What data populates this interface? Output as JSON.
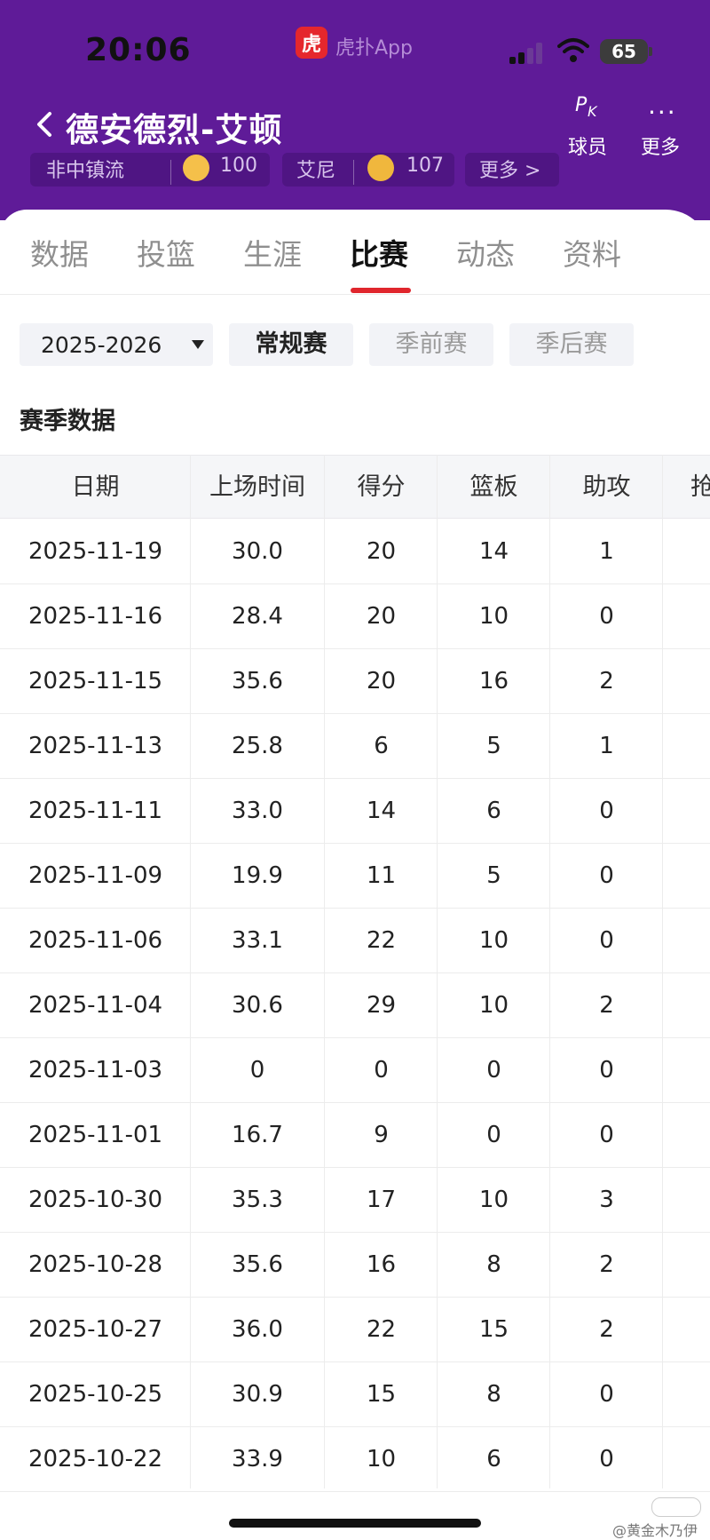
{
  "status_bar": {
    "time": "20:06",
    "app_name": "虎扑App",
    "app_logo_char": "虎",
    "battery": "65"
  },
  "header": {
    "title": "德安德烈-艾顿",
    "pk_label": "PK",
    "pk_text": "球员",
    "more_text": "更多",
    "more_dots": "···"
  },
  "badges": [
    {
      "label": "非中镇流",
      "value": "100"
    },
    {
      "label": "艾尼",
      "value": "107"
    },
    {
      "label": "更多 >"
    }
  ],
  "tabs": [
    "数据",
    "投篮",
    "生涯",
    "比赛",
    "动态",
    "资料"
  ],
  "active_tab": "比赛",
  "filters": {
    "season": "2025-2026",
    "types": [
      "常规赛",
      "季前赛",
      "季后赛"
    ],
    "active_type": "常规赛"
  },
  "section_title": "赛季数据",
  "table": {
    "columns": [
      "日期",
      "上场时间",
      "得分",
      "篮板",
      "助攻",
      "抢"
    ],
    "rows": [
      [
        "2025-11-19",
        "30.0",
        "20",
        "14",
        "1"
      ],
      [
        "2025-11-16",
        "28.4",
        "20",
        "10",
        "0"
      ],
      [
        "2025-11-15",
        "35.6",
        "20",
        "16",
        "2"
      ],
      [
        "2025-11-13",
        "25.8",
        "6",
        "5",
        "1"
      ],
      [
        "2025-11-11",
        "33.0",
        "14",
        "6",
        "0"
      ],
      [
        "2025-11-09",
        "19.9",
        "11",
        "5",
        "0"
      ],
      [
        "2025-11-06",
        "33.1",
        "22",
        "10",
        "0"
      ],
      [
        "2025-11-04",
        "30.6",
        "29",
        "10",
        "2"
      ],
      [
        "2025-11-03",
        "0",
        "0",
        "0",
        "0"
      ],
      [
        "2025-11-01",
        "16.7",
        "9",
        "0",
        "0"
      ],
      [
        "2025-10-30",
        "35.3",
        "17",
        "10",
        "3"
      ],
      [
        "2025-10-28",
        "35.6",
        "16",
        "8",
        "2"
      ],
      [
        "2025-10-27",
        "36.0",
        "22",
        "15",
        "2"
      ],
      [
        "2025-10-25",
        "30.9",
        "15",
        "8",
        "0"
      ],
      [
        "2025-10-22",
        "33.9",
        "10",
        "6",
        "0"
      ]
    ]
  },
  "watermark": "@黄金木乃伊",
  "colors": {
    "header_bg": "#5f1b98",
    "accent_red": "#e0262d",
    "logo_red": "#e5272d"
  }
}
